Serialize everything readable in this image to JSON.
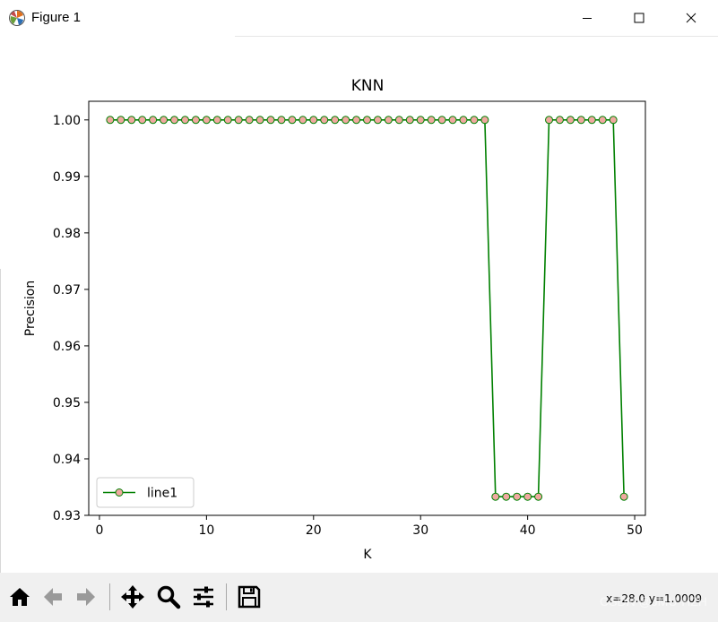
{
  "window": {
    "title": "Figure 1",
    "app_icon": "matplotlib-icon",
    "controls": [
      "minimize-icon",
      "maximize-icon",
      "close-icon"
    ]
  },
  "chart_data": {
    "type": "line",
    "title": "KNN",
    "xlabel": "K",
    "ylabel": "Precision",
    "xlim": [
      -1,
      51
    ],
    "ylim": [
      0.93,
      1.0033
    ],
    "xticks": [
      0,
      10,
      20,
      30,
      40,
      50
    ],
    "xtick_labels": [
      "0",
      "10",
      "20",
      "30",
      "40",
      "50"
    ],
    "yticks": [
      0.93,
      0.94,
      0.95,
      0.96,
      0.97,
      0.98,
      0.99,
      1.0
    ],
    "ytick_labels": [
      "0.93",
      "0.94",
      "0.95",
      "0.96",
      "0.97",
      "0.98",
      "0.99",
      "1.00"
    ],
    "grid": false,
    "legend": "lower-left",
    "series": [
      {
        "name": "line1",
        "color": "#008000",
        "marker_face": "#f0a8a0",
        "marker": "circle",
        "x": [
          1,
          2,
          3,
          4,
          5,
          6,
          7,
          8,
          9,
          10,
          11,
          12,
          13,
          14,
          15,
          16,
          17,
          18,
          19,
          20,
          21,
          22,
          23,
          24,
          25,
          26,
          27,
          28,
          29,
          30,
          31,
          32,
          33,
          34,
          35,
          36,
          37,
          38,
          39,
          40,
          41,
          42,
          43,
          44,
          45,
          46,
          47,
          48,
          49
        ],
        "y": [
          1.0,
          1.0,
          1.0,
          1.0,
          1.0,
          1.0,
          1.0,
          1.0,
          1.0,
          1.0,
          1.0,
          1.0,
          1.0,
          1.0,
          1.0,
          1.0,
          1.0,
          1.0,
          1.0,
          1.0,
          1.0,
          1.0,
          1.0,
          1.0,
          1.0,
          1.0,
          1.0,
          1.0,
          1.0,
          1.0,
          1.0,
          1.0,
          1.0,
          1.0,
          1.0,
          1.0,
          0.9333,
          0.9333,
          0.9333,
          0.9333,
          0.9333,
          1.0,
          1.0,
          1.0,
          1.0,
          1.0,
          1.0,
          1.0,
          0.9333
        ]
      }
    ]
  },
  "toolbar": {
    "buttons": [
      "home-icon",
      "back-icon",
      "forward-icon",
      "pan-icon",
      "zoom-icon",
      "configure-subplots-icon",
      "save-icon"
    ],
    "coords_readout": "x=28.0 y=1.0009",
    "watermark": "CSDN @JMU-HZH"
  }
}
